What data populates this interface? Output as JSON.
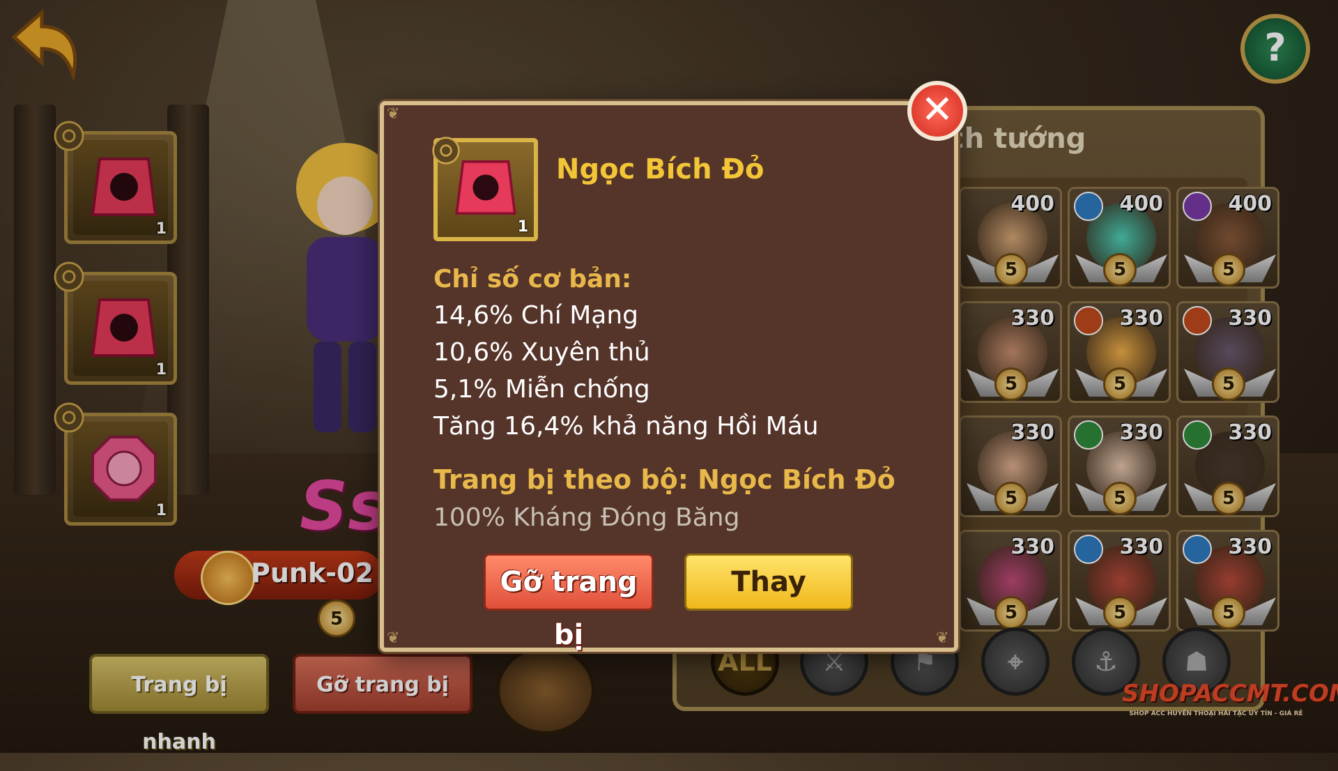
{
  "background_colors": {
    "wall": "#3a2c1f",
    "panel": "#55342a",
    "accent": "#f3c637"
  },
  "hero": {
    "name": "Punk-02 L",
    "stars": "5",
    "rank_badge": "Ss"
  },
  "gem_slots": [
    {
      "count": "1",
      "icon": "red-gem-icon"
    },
    {
      "count": "1",
      "icon": "red-gem-icon"
    },
    {
      "count": "1",
      "icon": "pink-gem-icon"
    }
  ],
  "bottom_buttons": {
    "quick_equip": "Trang bị nhanh",
    "unequip": "Gỡ trang bị"
  },
  "list_panel": {
    "title": "ch tướng",
    "cards": [
      {
        "power": "400",
        "stars": "5",
        "element": "none",
        "color": "#d8a878"
      },
      {
        "power": "400",
        "stars": "5",
        "element": "water",
        "color": "#4ed0b8"
      },
      {
        "power": "400",
        "stars": "5",
        "element": "mind",
        "color": "#8a5a3a"
      },
      {
        "power": "330",
        "stars": "5",
        "element": "none",
        "color": "#c89070"
      },
      {
        "power": "330",
        "stars": "5",
        "element": "fist",
        "color": "#f2b04a"
      },
      {
        "power": "330",
        "stars": "5",
        "element": "fist",
        "color": "#6a5a70"
      },
      {
        "power": "330",
        "stars": "5",
        "element": "none",
        "color": "#e0b090"
      },
      {
        "power": "330",
        "stars": "5",
        "element": "eye",
        "color": "#e8c8b0"
      },
      {
        "power": "330",
        "stars": "5",
        "element": "eye",
        "color": "#4a3a30"
      },
      {
        "power": "330",
        "stars": "5",
        "element": "none",
        "color": "#c04a7a"
      },
      {
        "power": "330",
        "stars": "5",
        "element": "water",
        "color": "#b84a3a"
      },
      {
        "power": "330",
        "stars": "5",
        "element": "water",
        "color": "#b84a3a"
      }
    ],
    "filters": [
      "ALL",
      "sword-icon",
      "flag-icon",
      "target-icon",
      "anchor-icon",
      "helmet-icon"
    ]
  },
  "modal": {
    "item_name": "Ngọc Bích Đỏ",
    "item_count": "1",
    "base_stats_title": "Chỉ số cơ bản:",
    "stats": [
      "14,6% Chí Mạng",
      "10,6% Xuyên thủ",
      "5,1% Miễn chống",
      "Tăng 16,4% khả năng Hồi Máu"
    ],
    "set_title": "Trang bị theo bộ: Ngọc Bích Đỏ",
    "set_bonus": "100% Kháng Đóng Băng",
    "unequip_label": "Gỡ trang bị",
    "replace_label": "Thay"
  },
  "watermark": {
    "text": "SHOPACCMT.COM",
    "subtext": "SHOP ACC HUYỀN THOẠI HẢI TẶC UY TÍN - GIÁ RẺ"
  }
}
